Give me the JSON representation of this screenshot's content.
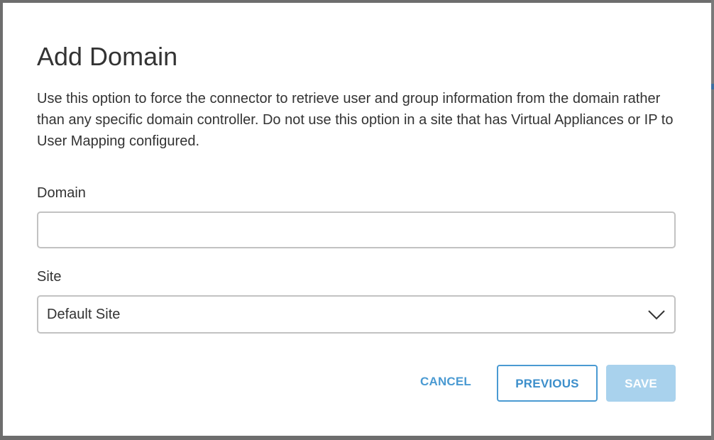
{
  "dialog": {
    "title": "Add Domain",
    "description": "Use this option to force the connector to retrieve user and group information from the domain rather than any specific domain controller. Do not use this option in a site that has Virtual Appliances or IP to User Mapping configured.",
    "domain_label": "Domain",
    "domain_value": "",
    "domain_placeholder": "",
    "site_label": "Site",
    "site_value": "Default Site",
    "site_dropdown_icon": "chevron-down-icon",
    "buttons": {
      "cancel": "CANCEL",
      "previous": "PREVIOUS",
      "save": "SAVE"
    },
    "save_enabled": false
  },
  "colors": {
    "accent": "#4a9ad2",
    "save_disabled": "#a9d2ed",
    "text": "#333333",
    "overlay": "#6d6d6d"
  }
}
